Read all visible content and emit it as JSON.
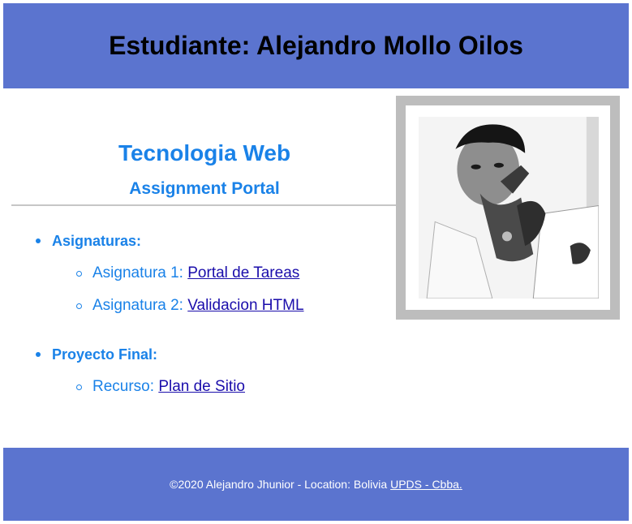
{
  "header": {
    "title": "Estudiante: Alejandro Mollo Oilos"
  },
  "hero": {
    "title": "Tecnologia Web",
    "subtitle": "Assignment Portal"
  },
  "sections": [
    {
      "label": "Asignaturas:",
      "items": [
        {
          "prefix": "Asignatura 1: ",
          "link": "Portal de Tareas"
        },
        {
          "prefix": "Asignatura 2: ",
          "link": "Validacion HTML"
        }
      ]
    },
    {
      "label": "Proyecto Final:",
      "items": [
        {
          "prefix": "Recurso: ",
          "link": "Plan de Sitio"
        }
      ]
    }
  ],
  "footer": {
    "text": "©2020 Alejandro Jhunior - Location: Bolivia",
    "link": "UPDS - Cbba."
  },
  "colors": {
    "banner": "#5b74cf",
    "accent": "#1a82e8",
    "link": "#1a0dab",
    "frame": "#bdbdbd"
  }
}
